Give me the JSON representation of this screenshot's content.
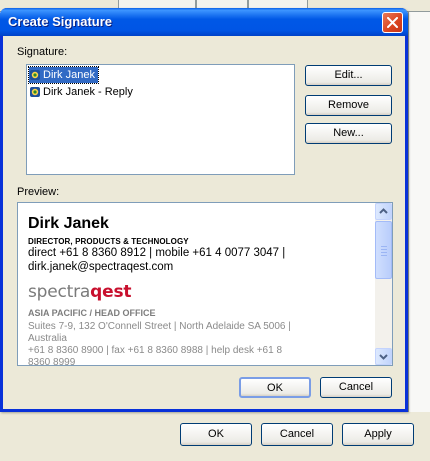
{
  "dialog": {
    "title": "Create Signature",
    "signature_label": "Signature:",
    "preview_label": "Preview:",
    "signatures": [
      {
        "label": "Dirk Janek",
        "selected": true
      },
      {
        "label": "Dirk Janek - Reply",
        "selected": false
      }
    ],
    "buttons": {
      "edit": "Edit...",
      "remove": "Remove",
      "new": "New...",
      "ok": "OK",
      "cancel": "Cancel"
    }
  },
  "preview": {
    "name": "Dirk Janek",
    "title": "DIRECTOR, PRODUCTS & TECHNOLOGY",
    "phone_line": "direct +61 8 8360 8912 | mobile +61 4 0077 3047 |",
    "email_line": "dirk.janek@spectraqest.com",
    "logo_part1": "spectra",
    "logo_part2": "qest",
    "office": "ASIA PACIFIC / HEAD OFFICE",
    "address_line1": "Suites 7-9, 132 O'Connell Street | North Adelaide SA 5006 |",
    "address_line2": "Australia",
    "address_line3": "+61 8 8360 8900 | fax +61 8 8360 8988 | help desk +61 8",
    "address_line4": "8360 8999"
  },
  "parent_dialog": {
    "ok": "OK",
    "cancel": "Cancel",
    "apply": "Apply"
  },
  "colors": {
    "titlebar": "#0058e6",
    "selection": "#316ac5",
    "logo_accent": "#c8102e"
  }
}
